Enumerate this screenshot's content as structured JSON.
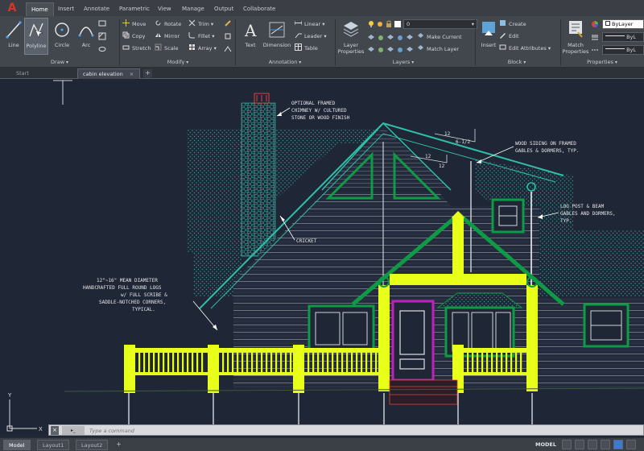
{
  "app": {
    "logo": "A"
  },
  "menu_tabs": [
    "Home",
    "Insert",
    "Annotate",
    "Parametric",
    "View",
    "Manage",
    "Output",
    "Collaborate"
  ],
  "draw_tools": [
    "Line",
    "Polyline",
    "Circle",
    "Arc"
  ],
  "modify_tools": [
    "Move",
    "Rotate",
    "Trim",
    "Copy",
    "Mirror",
    "Fillet",
    "Stretch",
    "Scale",
    "Array"
  ],
  "annotation_tools": {
    "text": "Text",
    "dimension": "Dimension",
    "linear": "Linear",
    "leader": "Leader",
    "table": "Table"
  },
  "layer_tools": {
    "properties": "Layer Properties",
    "current_layer": "0",
    "make_current": "Make Current",
    "match_layer": "Match Layer"
  },
  "block_tools": {
    "insert": "Insert",
    "create": "Create",
    "edit": "Edit",
    "edit_attributes": "Edit Attributes"
  },
  "property_tools": {
    "match": "Match Properties",
    "bylayer": "ByLayer",
    "by1": "ByL",
    "by2": "ByL"
  },
  "panels": {
    "draw": "Draw",
    "modify": "Modify",
    "annotation": "Annotation",
    "layers": "Layers",
    "block": "Block",
    "properties": "Properties"
  },
  "doc_tabs": {
    "start": "Start",
    "active": "cabin elevation"
  },
  "notes": {
    "chimney_1": "OPTIONAL FRAMED",
    "chimney_2": "CHIMNEY W/ CULTURED",
    "chimney_3": "STONE OR WOOD FINISH",
    "siding_1": "WOOD SIDING ON FRAMED",
    "siding_2": "GABLES & DORMERS, TYP.",
    "post_1": "LOG POST & BEAM",
    "post_2": "GABLES AND DORMERS,",
    "post_3": "TYP.",
    "cricket": "CRICKET",
    "logs_1": "12\"~16\" MEAN DIAMETER",
    "logs_2": "HANDCRAFTED FULL ROUND LOGS",
    "logs_3": "w/ FULL SCRIBE &",
    "logs_4": "SADDLE-NOTCHED CORNERS,",
    "logs_5": "TYPICAL.",
    "pitch_a_rise": "12",
    "pitch_a_run": "6-1/2",
    "pitch_b_rise": "12",
    "pitch_b_run": "12"
  },
  "ucs": {
    "y": "Y",
    "x": "X"
  },
  "command": {
    "placeholder": "Type a command"
  },
  "layout_tabs": [
    "Model",
    "Layout1",
    "Layout2"
  ],
  "status": {
    "model_label": "MODEL"
  },
  "colors": {
    "highlight": "#e8ff1a",
    "trim": "#0f9a46",
    "roof": "#2fbfa8",
    "door": "#c020c0"
  }
}
